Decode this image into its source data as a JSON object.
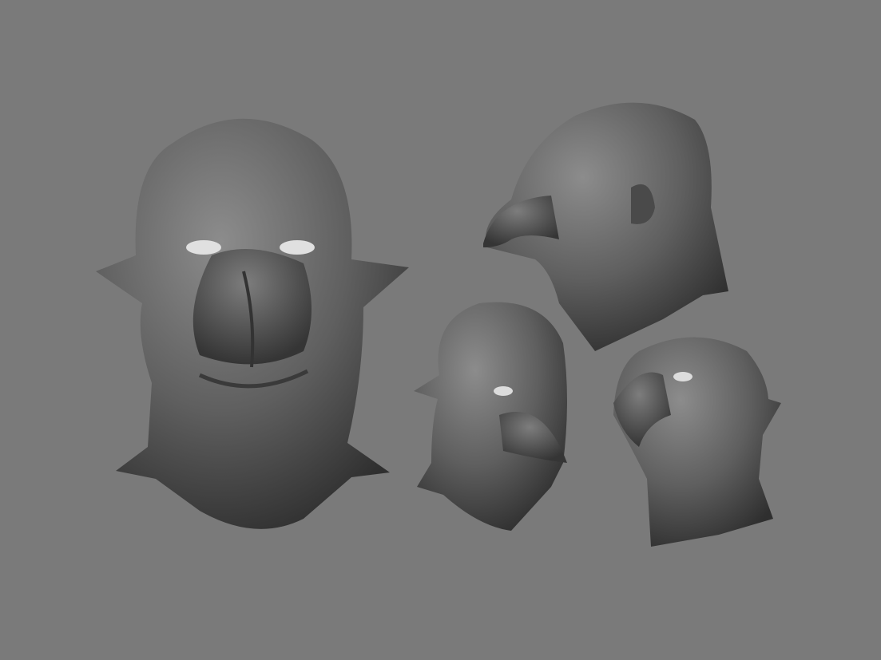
{
  "scene": {
    "background_color": "#7a7a7a",
    "sculpt_color_light": "#8a8a8a",
    "sculpt_color_mid": "#5e5e5e",
    "sculpt_color_dark": "#2e2e2e",
    "views": [
      "front",
      "three-quarter-left",
      "profile-left",
      "upward-three-quarter"
    ]
  }
}
